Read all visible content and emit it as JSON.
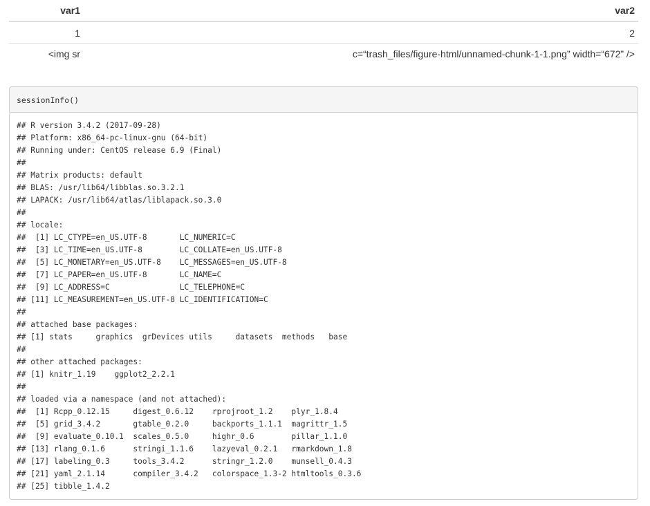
{
  "table": {
    "headers": [
      "var1",
      "var2"
    ],
    "rows": [
      [
        "1",
        "2"
      ],
      [
        "<img sr",
        "c=“trash_files/figure-html/unnamed-chunk-1-1.png” width=“672” />"
      ]
    ]
  },
  "code_block": {
    "text": "sessionInfo()"
  },
  "output": {
    "lines": [
      "## R version 3.4.2 (2017-09-28)",
      "## Platform: x86_64-pc-linux-gnu (64-bit)",
      "## Running under: CentOS release 6.9 (Final)",
      "## ",
      "## Matrix products: default",
      "## BLAS: /usr/lib64/libblas.so.3.2.1",
      "## LAPACK: /usr/lib64/atlas/liblapack.so.3.0",
      "## ",
      "## locale:",
      "##  [1] LC_CTYPE=en_US.UTF-8       LC_NUMERIC=C              ",
      "##  [3] LC_TIME=en_US.UTF-8        LC_COLLATE=en_US.UTF-8    ",
      "##  [5] LC_MONETARY=en_US.UTF-8    LC_MESSAGES=en_US.UTF-8   ",
      "##  [7] LC_PAPER=en_US.UTF-8       LC_NAME=C                 ",
      "##  [9] LC_ADDRESS=C               LC_TELEPHONE=C            ",
      "## [11] LC_MEASUREMENT=en_US.UTF-8 LC_IDENTIFICATION=C       ",
      "## ",
      "## attached base packages:",
      "## [1] stats     graphics  grDevices utils     datasets  methods   base     ",
      "## ",
      "## other attached packages:",
      "## [1] knitr_1.19    ggplot2_2.2.1",
      "## ",
      "## loaded via a namespace (and not attached):",
      "##  [1] Rcpp_0.12.15     digest_0.6.12    rprojroot_1.2    plyr_1.8.4      ",
      "##  [5] grid_3.4.2       gtable_0.2.0     backports_1.1.1  magrittr_1.5    ",
      "##  [9] evaluate_0.10.1  scales_0.5.0     highr_0.6        pillar_1.1.0    ",
      "## [13] rlang_0.1.6      stringi_1.1.6    lazyeval_0.2.1   rmarkdown_1.8   ",
      "## [17] labeling_0.3     tools_3.4.2      stringr_1.2.0    munsell_0.4.3   ",
      "## [21] yaml_2.1.14      compiler_3.4.2   colorspace_1.3-2 htmltools_0.3.6 ",
      "## [25] tibble_1.4.2"
    ]
  }
}
